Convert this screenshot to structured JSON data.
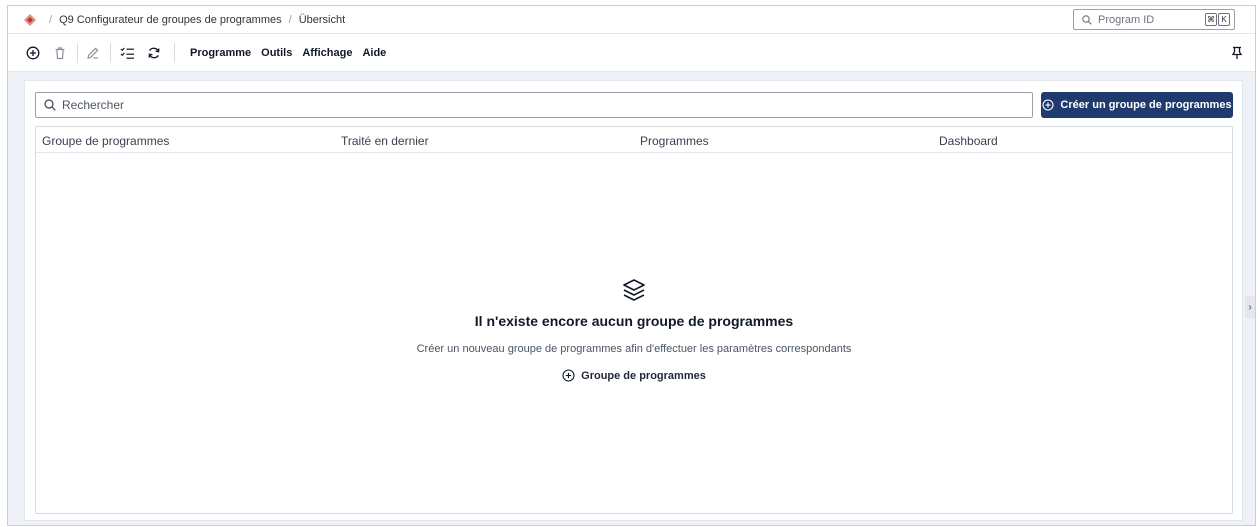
{
  "titlebar": {
    "breadcrumbs": [
      "Q9 Configurateur de groupes de programmes",
      "Übersicht"
    ],
    "program_search": {
      "placeholder": "Program ID",
      "shortcut_keys": [
        "⌘",
        "K"
      ]
    }
  },
  "toolbar": {
    "icons": [
      "add-icon",
      "trash-icon",
      "edit-icon",
      "checklist-icon",
      "refresh-icon"
    ],
    "menu": [
      "Programme",
      "Outils",
      "Affichage",
      "Aide"
    ],
    "pin_icon": "pin-icon"
  },
  "main": {
    "search_placeholder": "Rechercher",
    "create_button_label": "Créer un groupe de programmes",
    "columns": [
      "Groupe de programmes",
      "Traité en dernier",
      "Programmes",
      "Dashboard"
    ],
    "empty_state": {
      "icon": "layers-icon",
      "title": "Il n'existe encore aucun groupe de programmes",
      "description": "Créer un nouveau groupe de programmes afin d'effectuer les paramètres correspondants",
      "action_label": "Groupe de programmes"
    }
  },
  "colors": {
    "accent": "#1f3a6e",
    "logo": "#c0392b"
  }
}
